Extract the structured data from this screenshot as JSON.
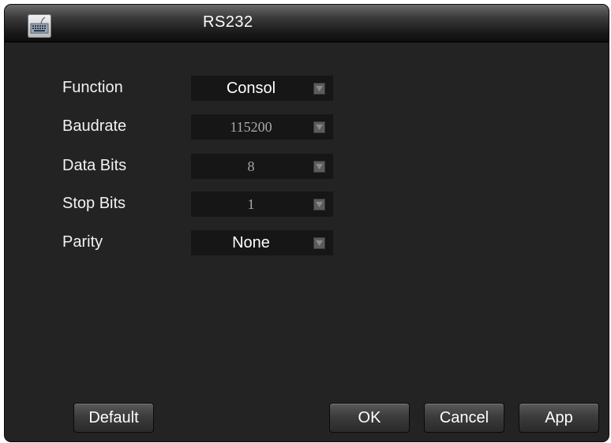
{
  "window": {
    "title": "RS232",
    "icon": "keyboard-icon"
  },
  "form": {
    "rows": [
      {
        "label": "Function",
        "value": "Consol"
      },
      {
        "label": "Baudrate",
        "value": "115200"
      },
      {
        "label": "Data Bits",
        "value": "8"
      },
      {
        "label": "Stop Bits",
        "value": "1"
      },
      {
        "label": "Parity",
        "value": "None"
      }
    ]
  },
  "buttons": {
    "default": "Default",
    "ok": "OK",
    "cancel": "Cancel",
    "apply": "App"
  },
  "colors": {
    "window_bg": "#232323",
    "field_bg": "#161616",
    "text": "#ffffff",
    "dim_text": "#a8a8a8"
  }
}
